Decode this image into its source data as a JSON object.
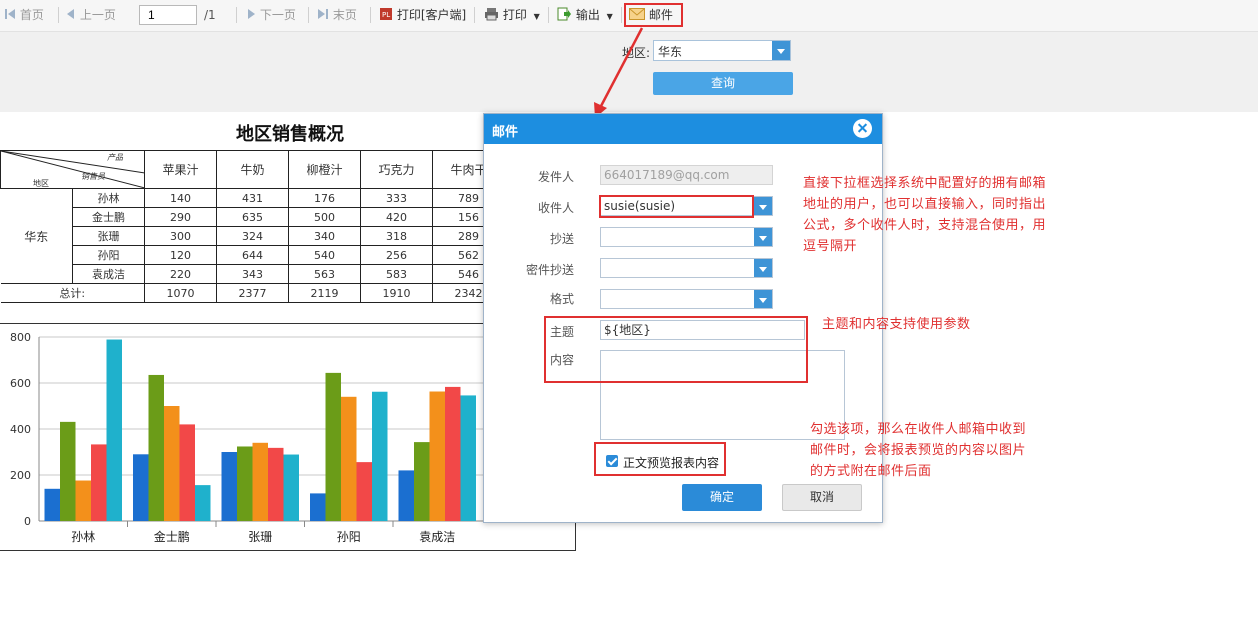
{
  "toolbar": {
    "first_page": "首页",
    "prev_page": "上一页",
    "page_value": "1",
    "page_total": "/1",
    "next_page": "下一页",
    "last_page": "末页",
    "print_client": "打印[客户端]",
    "print": "打印",
    "export": "输出",
    "mail": "邮件"
  },
  "params": {
    "region_label": "地区:",
    "region_value": "华东",
    "query_label": "查询"
  },
  "report": {
    "title": "地区销售概况",
    "header_corner": {
      "product": "产品",
      "salesperson": "销售员",
      "region": "地区"
    },
    "columns": [
      "苹果汁",
      "牛奶",
      "柳橙汁",
      "巧克力",
      "牛肉干"
    ],
    "region": "华东",
    "rows": [
      {
        "name": "孙林",
        "values": [
          "140",
          "431",
          "176",
          "333",
          "789"
        ]
      },
      {
        "name": "金士鹏",
        "values": [
          "290",
          "635",
          "500",
          "420",
          "156"
        ]
      },
      {
        "name": "张珊",
        "values": [
          "300",
          "324",
          "340",
          "318",
          "289"
        ]
      },
      {
        "name": "孙阳",
        "values": [
          "120",
          "644",
          "540",
          "256",
          "562"
        ]
      },
      {
        "name": "袁成洁",
        "values": [
          "220",
          "343",
          "563",
          "583",
          "546"
        ]
      }
    ],
    "total_label": "总计:",
    "totals": [
      "1070",
      "2377",
      "2119",
      "1910",
      "2342"
    ]
  },
  "chart_data": {
    "type": "bar",
    "categories": [
      "孙林",
      "金士鹏",
      "张珊",
      "孙阳",
      "袁成洁"
    ],
    "series": [
      {
        "values": [
          140,
          290,
          300,
          120,
          220
        ],
        "color": "#1b6fd0"
      },
      {
        "values": [
          431,
          635,
          324,
          644,
          343
        ],
        "color": "#6b9c18"
      },
      {
        "values": [
          176,
          500,
          340,
          540,
          563
        ],
        "color": "#f3901b"
      },
      {
        "values": [
          333,
          420,
          318,
          256,
          583
        ],
        "color": "#f24848"
      },
      {
        "values": [
          789,
          156,
          289,
          562,
          546
        ],
        "color": "#1fb1cc"
      }
    ],
    "ylim": [
      0,
      800
    ],
    "yticks": [
      0,
      200,
      400,
      600,
      800
    ],
    "grid": true
  },
  "dialog": {
    "title": "邮件",
    "sender_label": "发件人",
    "sender_value": "664017189@qq.com",
    "recipient_label": "收件人",
    "recipient_value": "susie(susie)",
    "cc_label": "抄送",
    "bcc_label": "密件抄送",
    "format_label": "格式",
    "subject_label": "主题",
    "subject_value": "${地区}",
    "content_label": "内容",
    "preview_checkbox_label": "正文预览报表内容",
    "ok_label": "确定",
    "cancel_label": "取消"
  },
  "annotations": {
    "recipient_note": [
      "直接下拉框选择系统中配置好的拥有邮箱",
      "地址的用户，也可以直接输入，同时指出",
      "公式，多个收件人时，支持混合使用，用",
      "逗号隔开"
    ],
    "subject_note": [
      "主题和内容支持使用参数"
    ],
    "preview_note": [
      "勾选该项，那么在收件人邮箱中收到",
      "邮件时，会将报表预览的内容以图片",
      "的方式附在邮件后面"
    ]
  },
  "colors": {
    "accent": "#1d8ee0",
    "annotation": "#e03030"
  }
}
